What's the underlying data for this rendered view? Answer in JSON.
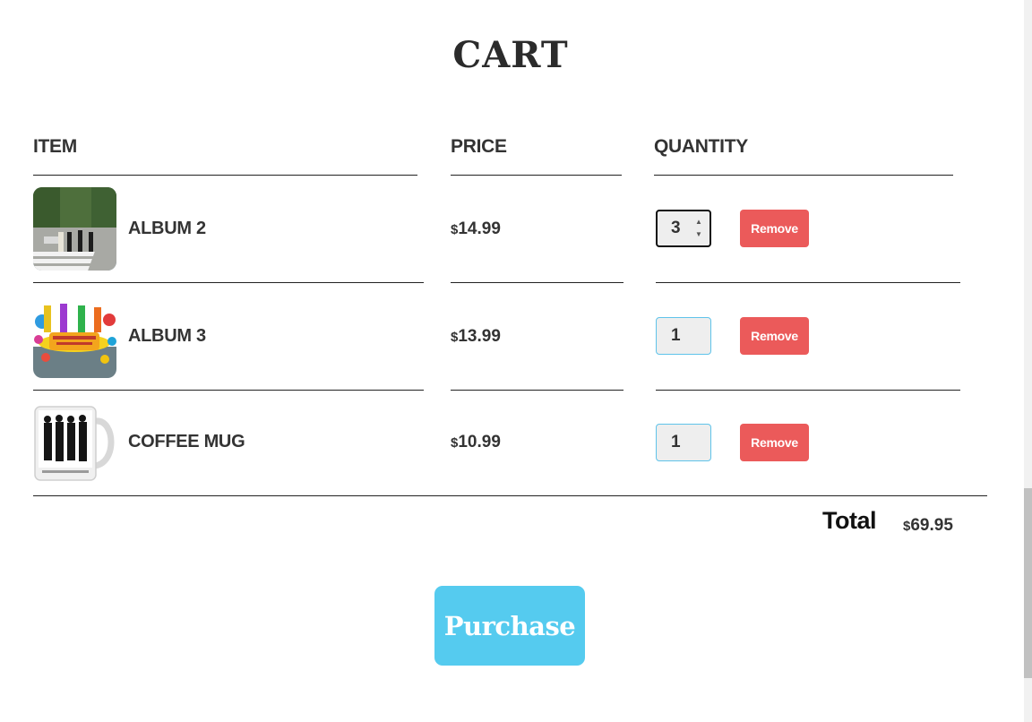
{
  "title": "CART",
  "columns": {
    "item": "ITEM",
    "price": "PRICE",
    "quantity": "QUANTITY"
  },
  "items": [
    {
      "name": "ALBUM 2",
      "currency": "$",
      "price": "14.99",
      "quantity": "3",
      "remove_label": "Remove",
      "image": "abbey-road-album-cover"
    },
    {
      "name": "ALBUM 3",
      "currency": "$",
      "price": "13.99",
      "quantity": "1",
      "remove_label": "Remove",
      "image": "yellow-submarine-album-cover"
    },
    {
      "name": "COFFEE MUG",
      "currency": "$",
      "price": "10.99",
      "quantity": "1",
      "remove_label": "Remove",
      "image": "beatles-coffee-mug"
    }
  ],
  "total": {
    "label": "Total",
    "currency": "$",
    "value": "69.95"
  },
  "purchase_label": "Purchase",
  "colors": {
    "remove": "#eb5a5a",
    "purchase": "#55cbef",
    "input_border": "#5fc3ea"
  }
}
